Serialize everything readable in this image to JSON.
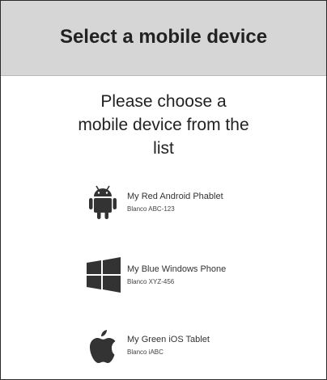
{
  "header": {
    "title": "Select a mobile device"
  },
  "prompt": {
    "line1": "Please choose a",
    "line2": "mobile device from the",
    "line3": "list"
  },
  "devices": [
    {
      "icon": "android-icon",
      "name": "My Red Android Phablet",
      "subtitle": "Blanco ABC-123"
    },
    {
      "icon": "windows-icon",
      "name": "My Blue Windows Phone",
      "subtitle": "Blanco XYZ-456"
    },
    {
      "icon": "apple-icon",
      "name": "My Green iOS Tablet",
      "subtitle": "Blanco iABC"
    }
  ],
  "colors": {
    "header_bg": "#d6d6d6",
    "icon": "#333333",
    "text": "#222222"
  }
}
